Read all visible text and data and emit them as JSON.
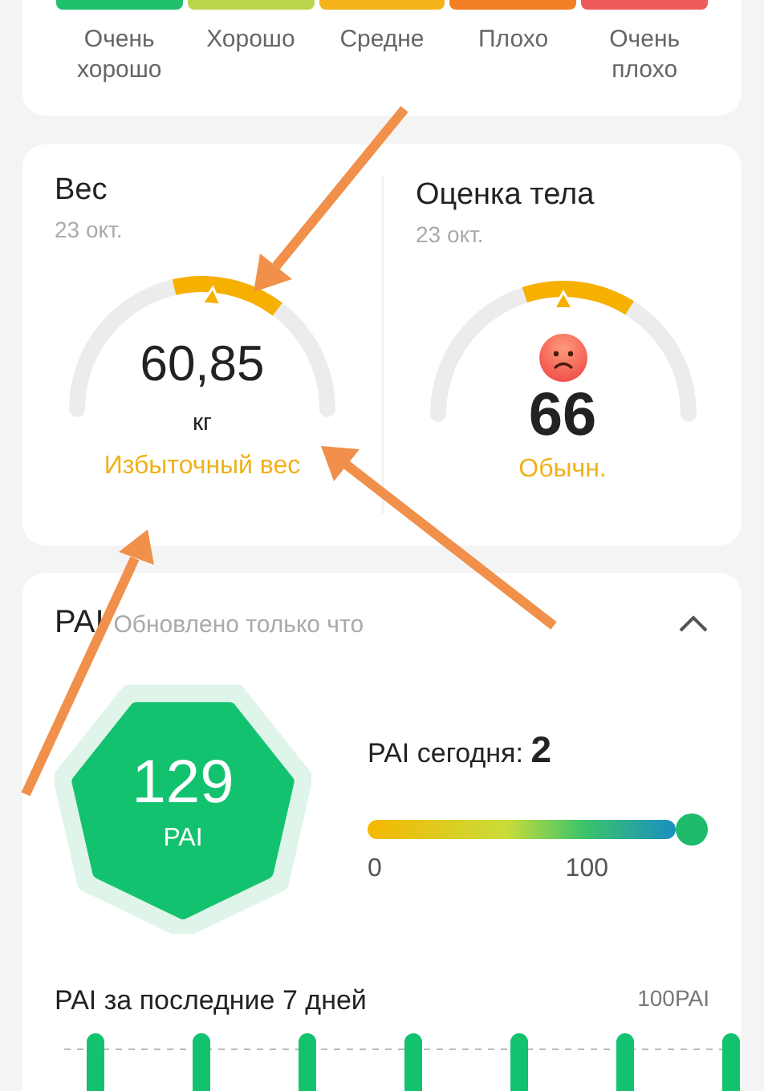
{
  "rating_scale": [
    {
      "label": "Очень хорошо",
      "color": "#1fbf6b"
    },
    {
      "label": "Хорошо",
      "color": "#b9d64a"
    },
    {
      "label": "Средне",
      "color": "#f6b21a"
    },
    {
      "label": "Плохо",
      "color": "#f47f25"
    },
    {
      "label": "Очень плохо",
      "color": "#ef5b5b"
    }
  ],
  "metrics": [
    {
      "kind": "weight",
      "title": "Вес",
      "date": "23 окт.",
      "value": "60,85",
      "unit": "кг",
      "status": "Избыточный вес"
    },
    {
      "kind": "score",
      "title": "Оценка тела",
      "date": "23 окт.",
      "value": "66",
      "status": "Обычн."
    }
  ],
  "pai": {
    "title": "PAI",
    "updated": "Обновлено только что",
    "expanded": true,
    "total": "129",
    "total_unit": "PAI",
    "today": "PAI сегодня: **2**",
    "scale_min": "0",
    "scale_max": "100",
    "week_title": "PAI за последние 7 дней",
    "week_max": "100PAI"
  }
}
